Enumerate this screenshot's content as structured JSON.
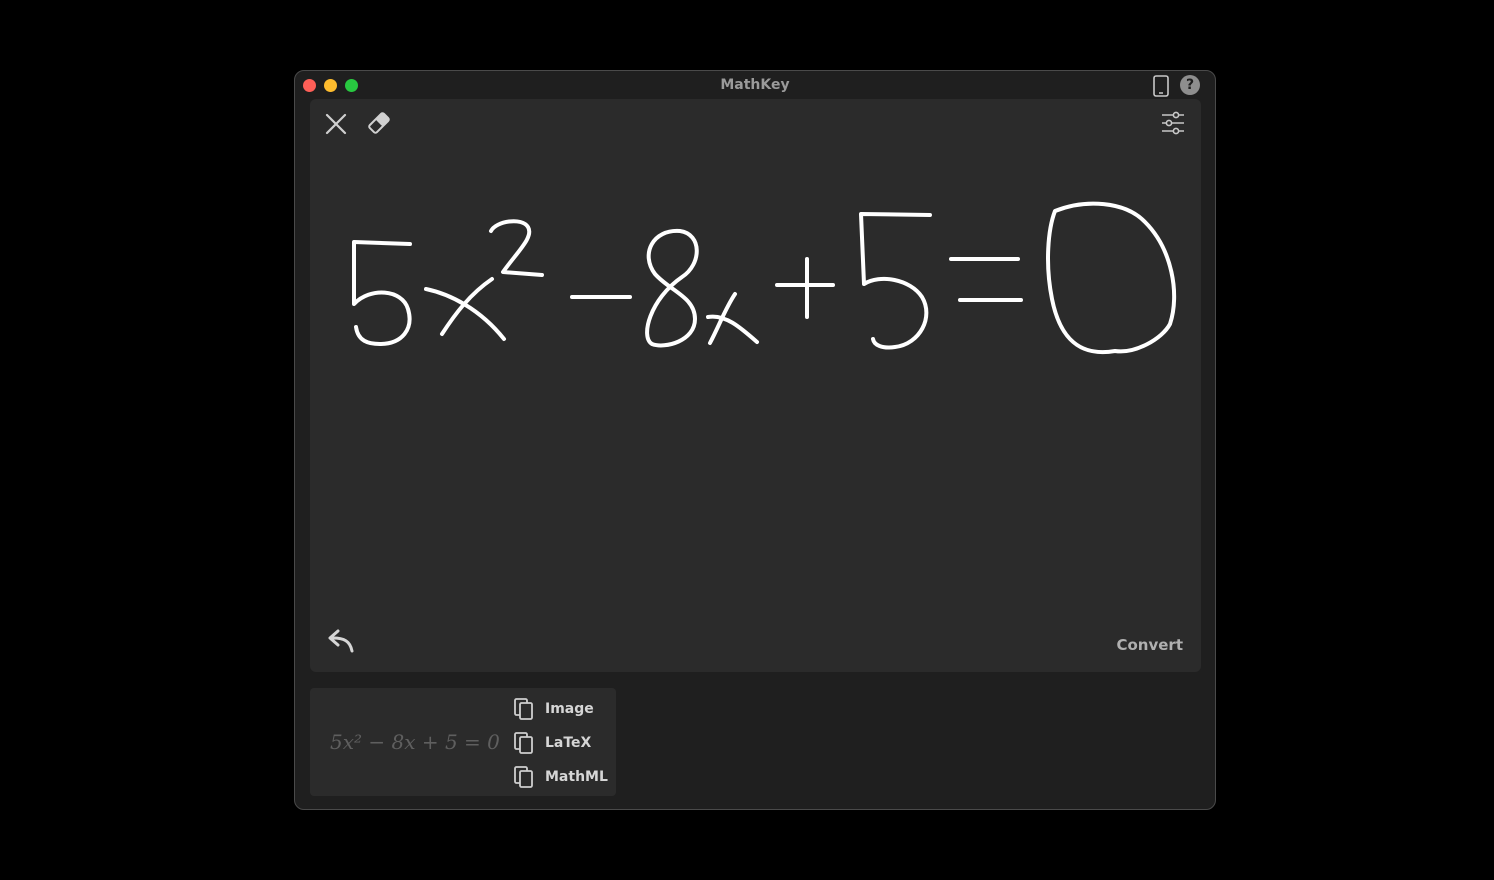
{
  "window": {
    "title": "MathKey"
  },
  "titlebar": {
    "icons": [
      "close-window",
      "minimize-window",
      "maximize-window",
      "ipad-icon",
      "help-icon"
    ],
    "help_label": "?"
  },
  "toolbar": {
    "icons": [
      "close-icon",
      "eraser-icon",
      "sliders-icon"
    ]
  },
  "canvas": {
    "ink_color": "#ffffff",
    "background": "#2b2b2b",
    "undo_icon": "undo-arrow-icon",
    "convert_label": "Convert"
  },
  "result": {
    "formula": "5x² − 8x + 5 = 0",
    "actions": [
      {
        "label": "Image",
        "icon": "copy-icon"
      },
      {
        "label": "LaTeX",
        "icon": "copy-icon"
      },
      {
        "label": "MathML",
        "icon": "copy-icon"
      }
    ]
  }
}
